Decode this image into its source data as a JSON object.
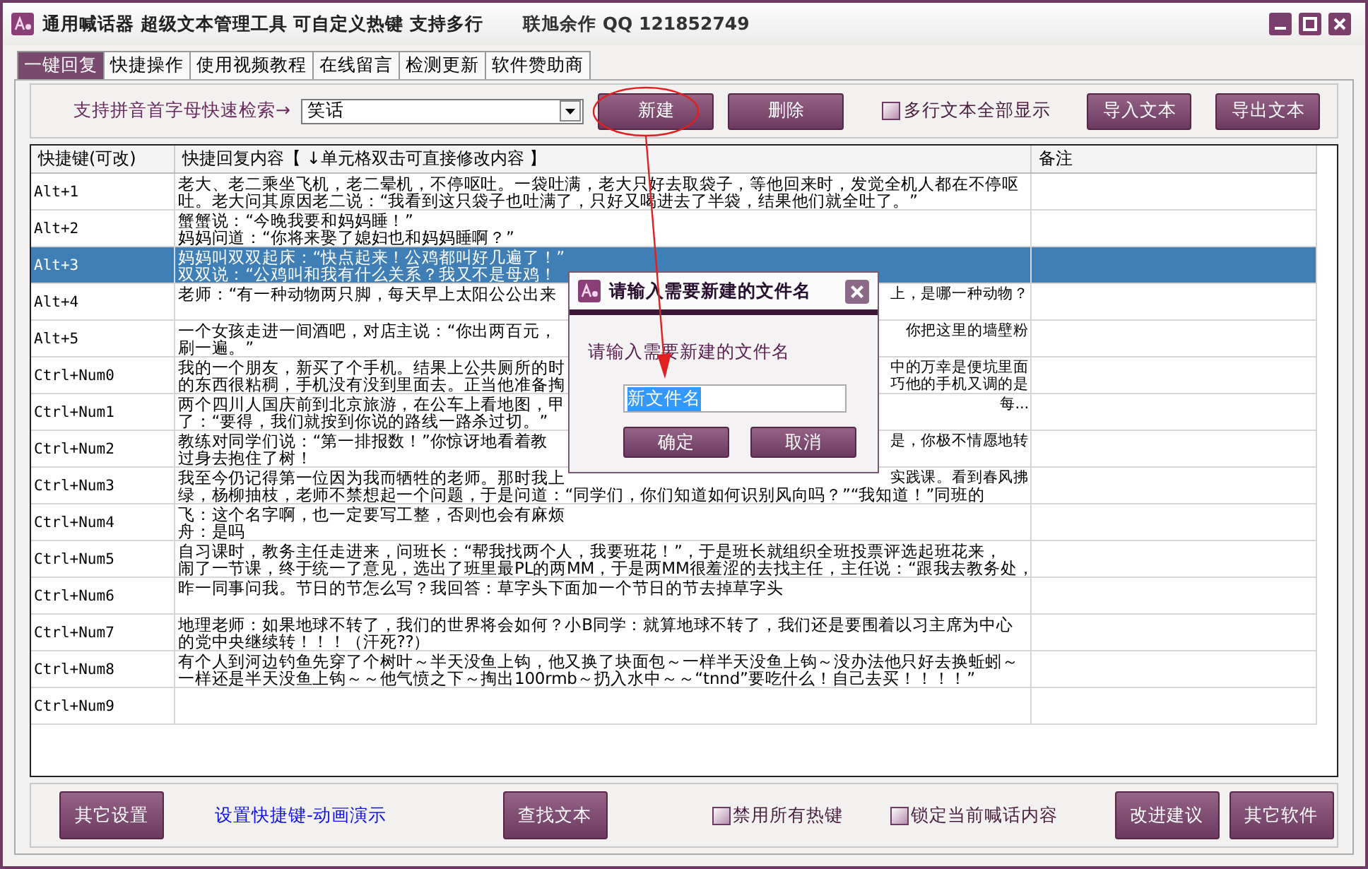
{
  "window": {
    "title": "通用喊话器 超级文本管理工具 可自定义热键 支持多行",
    "author": "联旭余作 QQ 121852749"
  },
  "tabs": [
    {
      "label": "一键回复",
      "selected": true
    },
    {
      "label": "快捷操作",
      "selected": false
    },
    {
      "label": "使用视频教程",
      "selected": false
    },
    {
      "label": "在线留言",
      "selected": false
    },
    {
      "label": "检测更新",
      "selected": false
    },
    {
      "label": "软件赞助商",
      "selected": false
    }
  ],
  "toolbar": {
    "search_label": "支持拼音首字母快速检索→",
    "category": "笑话",
    "new_button": "新建",
    "delete_button": "删除",
    "multiline": {
      "label": "多行文本全部显示",
      "checked": false
    },
    "import_button": "导入文本",
    "export_button": "导出文本"
  },
  "table": {
    "columns": [
      "快捷键(可改)",
      "快捷回复内容【 ↓单元格双击可直接修改内容 】",
      "备注"
    ],
    "rows": [
      {
        "key": "Alt+1",
        "selected": false,
        "lines": [
          {
            "text": "老大、老二乘坐飞机，老二晕机，不停呕吐。一袋吐满，老大只好去取袋子，等他回来时，发觉全机人都在不停呕"
          },
          {
            "text": "吐。老大问其原因老二说：“我看到这只袋子也吐满了，只好又喝进去了半袋，结果他们就全吐了。”"
          }
        ]
      },
      {
        "key": "Alt+2",
        "selected": false,
        "lines": [
          {
            "text": "蟹蟹说：“今晚我要和妈妈睡！”"
          },
          {
            "text": "妈妈问道：“你将来娶了媳妇也和妈妈睡啊？”"
          }
        ]
      },
      {
        "key": "Alt+3",
        "selected": true,
        "lines": [
          {
            "text": "妈妈叫双双起床：“快点起来！公鸡都叫好几遍了！”"
          },
          {
            "left": "双双说：“公鸡叫和我有什么关系？我又不是母鸡！"
          }
        ]
      },
      {
        "key": "Alt+4",
        "selected": false,
        "lines": [
          {
            "left": "老师：“有一种动物两只脚，每天早上太阳公公出来",
            "right": "上，是哪一种动物？"
          }
        ]
      },
      {
        "key": "Alt+5",
        "selected": false,
        "lines": [
          {
            "left": "一个女孩走进一间酒吧，对店主说：“你出两百元，",
            "right": "你把这里的墙壁粉"
          },
          {
            "left": "刷一遍。”"
          }
        ]
      },
      {
        "key": "Ctrl+Num0",
        "selected": false,
        "lines": [
          {
            "left": "我的一个朋友，新买了个手机。结果上公共厕所的时",
            "right": "中的万幸是便坑里面"
          },
          {
            "left": "的东西很粘稠，手机没有没到里面去。正当他准备掏",
            "right": "巧他的手机又调的是"
          }
        ]
      },
      {
        "key": "Ctrl+Num1",
        "selected": false,
        "lines": [
          {
            "left": "两个四川人国庆前到北京旅游，在公车上看地图，甲",
            "right": "每..."
          },
          {
            "left": "了：“要得，我们就按到你说的路线一路杀过切。”"
          }
        ]
      },
      {
        "key": "Ctrl+Num2",
        "selected": false,
        "lines": [
          {
            "left": "教练对同学们说：“第一排报数！”你惊讶地看着教",
            "right": "是，你极不情愿地转"
          },
          {
            "left": "过身去抱住了树！"
          }
        ]
      },
      {
        "key": "Ctrl+Num3",
        "selected": false,
        "lines": [
          {
            "left": "我至今仍记得第一位因为我而牺牲的老师。那时我上",
            "right": "实践课。看到春风拂"
          },
          {
            "text": "绿，杨柳抽枝，老师不禁想起一个问题，于是问道：“同学们，你们知道如何识别风向吗？”“我知道！”同班的"
          }
        ]
      },
      {
        "key": "Ctrl+Num4",
        "selected": false,
        "lines": [
          {
            "text": "飞：这个名字啊，也一定要写工整，否则也会有麻烦"
          },
          {
            "text": "舟：是吗"
          }
        ]
      },
      {
        "key": "Ctrl+Num5",
        "selected": false,
        "lines": [
          {
            "text": "自习课时，教务主任走进来，问班长：“帮我找两个人，我要班花！”，于是班长就组织全班投票评选起班花来，"
          },
          {
            "text": "闹了一节课，终于统一了意见，选出了班里最PL的两MM，于是两MM很羞涩的去找主任，主任说：“跟我去教务处，"
          }
        ]
      },
      {
        "key": "Ctrl+Num6",
        "selected": false,
        "lines": [
          {
            "text": "昨一同事问我。节日的节怎么写？我回答：草字头下面加一个节日的节去掉草字头"
          }
        ]
      },
      {
        "key": "Ctrl+Num7",
        "selected": false,
        "lines": [
          {
            "text": "地理老师：如果地球不转了，我们的世界将会如何？小B同学：就算地球不转了，我们还是要围着以习主席为中心"
          },
          {
            "text": "的党中央继续转！！！（汗死??）"
          }
        ]
      },
      {
        "key": "Ctrl+Num8",
        "selected": false,
        "lines": [
          {
            "text": "有个人到河边钓鱼先穿了个树叶～半天没鱼上钩，他又换了块面包～一样半天没鱼上钩～没办法他只好去换蚯蚓～"
          },
          {
            "text": "一样还是半天没鱼上钩～～他气愤之下～掏出100rmb～扔入水中～～“tnnd”要吃什么！自己去买！！！！”"
          }
        ]
      },
      {
        "key": "Ctrl+Num9",
        "selected": false,
        "lines": []
      }
    ]
  },
  "bottom_bar": [
    {
      "kind": "button",
      "label": "其它设置"
    },
    {
      "kind": "link",
      "label": "设置快捷键-动画演示"
    },
    {
      "kind": "button",
      "label": "查找文本"
    },
    {
      "kind": "checkbox",
      "label": "禁用所有热键",
      "checked": false
    },
    {
      "kind": "checkbox",
      "label": "锁定当前喊话内容",
      "checked": false
    },
    {
      "kind": "button",
      "label": "改进建议"
    },
    {
      "kind": "button",
      "label": "其它软件"
    }
  ],
  "dialog": {
    "title": "请输入需要新建的文件名",
    "prompt": "请输入需要新建的文件名",
    "value": "新文件名",
    "ok": "确定",
    "cancel": "取消"
  }
}
